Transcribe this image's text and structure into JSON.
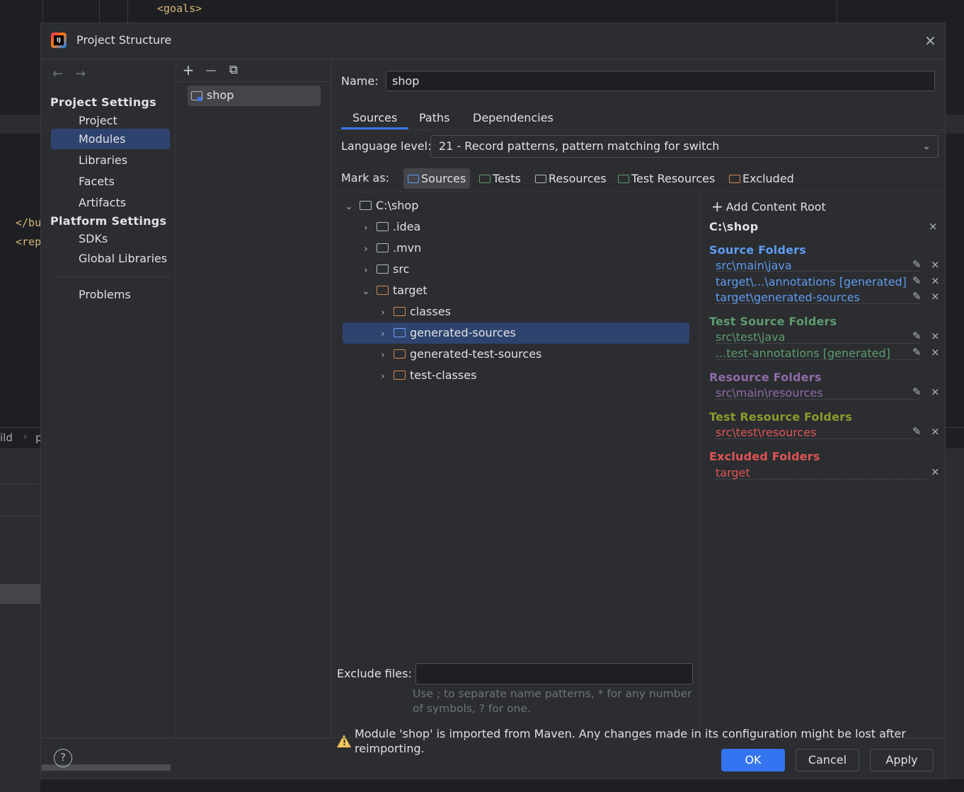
{
  "background": {
    "code_goals": "<goals>",
    "code_bu": "</bu",
    "code_rep": "<rep",
    "crumb": "ild",
    "crumb_chevron": "›",
    "crumb2": "p"
  },
  "dialog": {
    "title": "Project Structure",
    "close_icon": "×"
  },
  "nav": {
    "back": "←",
    "forward": "→",
    "project_settings": "Project Settings",
    "platform_settings": "Platform Settings",
    "items_project": [
      "Project",
      "Modules",
      "Libraries",
      "Facets",
      "Artifacts"
    ],
    "items_platform": [
      "SDKs",
      "Global Libraries"
    ],
    "problems": "Problems",
    "selected": "Modules"
  },
  "modules": {
    "add": "+",
    "remove": "—",
    "copy": "⧉",
    "items": [
      "shop"
    ]
  },
  "content": {
    "name_label": "Name:",
    "name_value": "shop",
    "tabs": [
      "Sources",
      "Paths",
      "Dependencies"
    ],
    "active_tab": "Sources",
    "language_level_label": "Language level:",
    "language_level_value": "21 - Record patterns, pattern matching for switch",
    "mark_as_label": "Mark as:",
    "mark_buttons": [
      "Sources",
      "Tests",
      "Resources",
      "Test Resources",
      "Excluded"
    ],
    "tree": [
      {
        "label": "C:\\shop",
        "caret": "⌄"
      },
      {
        "label": ".idea",
        "caret": "›"
      },
      {
        "label": ".mvn",
        "caret": "›"
      },
      {
        "label": "src",
        "caret": "›"
      },
      {
        "label": "target",
        "caret": "⌄"
      },
      {
        "label": "classes",
        "caret": "›"
      },
      {
        "label": "generated-sources",
        "caret": "›"
      },
      {
        "label": "generated-test-sources",
        "caret": "›"
      },
      {
        "label": "test-classes",
        "caret": "›"
      }
    ],
    "exclude_files_label": "Exclude files:",
    "exclude_files_value": "",
    "exclude_hint": "Use ; to separate name patterns, * for any number of symbols, ? for one.",
    "warning": "Module 'shop' is imported from Maven. Any changes made in its configuration might be lost after reimporting.",
    "warning_icon": "!"
  },
  "roots": {
    "add_content_root": "Add Content Root",
    "root": "C:\\shop",
    "source_folders_title": "Source Folders",
    "source_folders": [
      "src\\main\\java",
      "target\\...\\annotations [generated]",
      "target\\generated-sources"
    ],
    "test_source_folders_title": "Test Source Folders",
    "test_source_folders": [
      "src\\test\\java",
      "...test-annotations [generated]"
    ],
    "resource_folders_title": "Resource Folders",
    "resource_folders": [
      "src\\main\\resources"
    ],
    "test_resource_folders_title": "Test Resource Folders",
    "test_resource_folders": [
      "src\\test\\resources"
    ],
    "excluded_folders_title": "Excluded Folders",
    "excluded_folders": [
      "target"
    ],
    "edit_icon": "✎",
    "remove_icon": "×"
  },
  "footer": {
    "help": "?",
    "ok": "OK",
    "cancel": "Cancel",
    "apply": "Apply"
  },
  "colors": {
    "accent": "#3574f0",
    "selection": "#2e436e",
    "source": "#5f9bf0",
    "test": "#5e9b6e",
    "resource": "#8f6ba8",
    "test_resource": "#8a9c2c",
    "excluded": "#e05555"
  }
}
